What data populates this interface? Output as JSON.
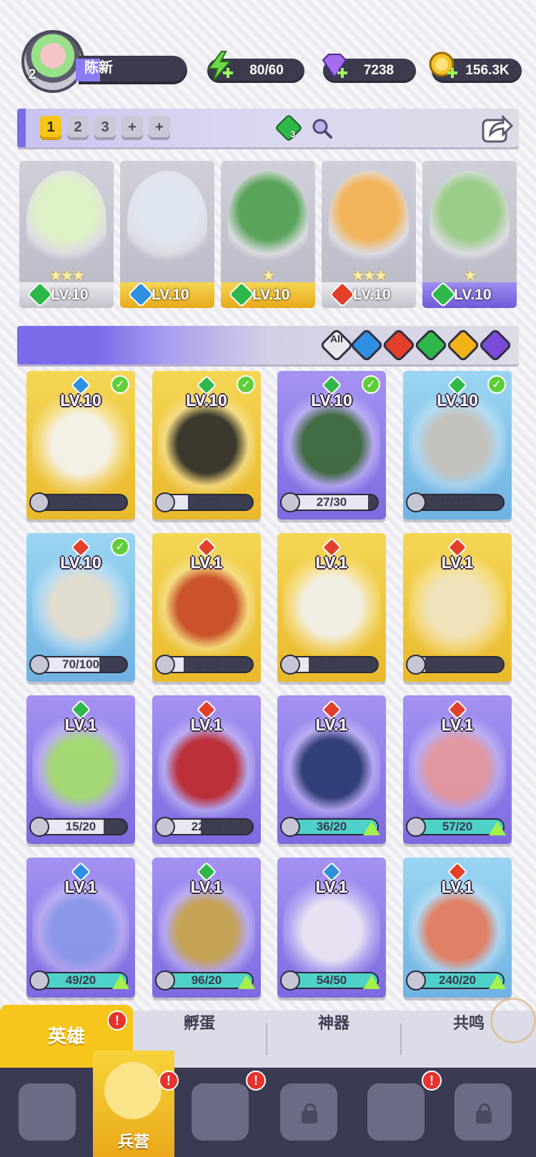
{
  "player": {
    "level": "2",
    "name": "陈新"
  },
  "resources": {
    "energy": "80/60",
    "gems": "7238",
    "gold": "156.3K"
  },
  "team": {
    "slots": [
      "1",
      "2",
      "3"
    ],
    "active_slot": "1",
    "add_slots": 2,
    "element_count": "3",
    "heroes": [
      {
        "level": "LV.10",
        "element": "nature",
        "stars": 3,
        "frame": "silver"
      },
      {
        "level": "LV.10",
        "element": "water",
        "stars": 0,
        "frame": "gold"
      },
      {
        "level": "LV.10",
        "element": "nature",
        "stars": 1,
        "frame": "gold"
      },
      {
        "level": "LV.10",
        "element": "fire",
        "stars": 3,
        "frame": "silver"
      },
      {
        "level": "LV.10",
        "element": "nature",
        "stars": 1,
        "frame": "purple"
      }
    ]
  },
  "filters": {
    "all_label": "All",
    "elements": [
      "water",
      "fire",
      "nature",
      "light",
      "dark"
    ]
  },
  "heroes": [
    {
      "level": "LV.10",
      "element": "water",
      "progress": "0/20",
      "fill": 0.0,
      "frame": "gold",
      "in_team": true,
      "upgrade": false
    },
    {
      "level": "LV.10",
      "element": "nature",
      "progress": "9/30",
      "fill": 0.3,
      "frame": "gold",
      "in_team": true,
      "upgrade": false
    },
    {
      "level": "LV.10",
      "element": "nature",
      "progress": "27/30",
      "fill": 0.9,
      "frame": "purple",
      "in_team": true,
      "upgrade": false
    },
    {
      "level": "LV.10",
      "element": "nature",
      "progress": "10/100",
      "fill": 0.1,
      "frame": "blue",
      "in_team": true,
      "upgrade": false
    },
    {
      "level": "LV.10",
      "element": "fire",
      "progress": "70/100",
      "fill": 0.7,
      "frame": "blue",
      "in_team": true,
      "upgrade": false
    },
    {
      "level": "LV.1",
      "element": "fire",
      "progress": "5/20",
      "fill": 0.25,
      "frame": "gold",
      "in_team": false,
      "upgrade": false
    },
    {
      "level": "LV.1",
      "element": "fire",
      "progress": "5/20",
      "fill": 0.25,
      "frame": "gold",
      "in_team": false,
      "upgrade": false
    },
    {
      "level": "LV.1",
      "element": "fire",
      "progress": "3/20",
      "fill": 0.15,
      "frame": "gold",
      "in_team": false,
      "upgrade": false
    },
    {
      "level": "LV.1",
      "element": "nature",
      "progress": "15/20",
      "fill": 0.75,
      "frame": "purple",
      "in_team": false,
      "upgrade": false
    },
    {
      "level": "LV.1",
      "element": "fire",
      "progress": "22/50",
      "fill": 0.44,
      "frame": "purple",
      "in_team": false,
      "upgrade": false
    },
    {
      "level": "LV.1",
      "element": "fire",
      "progress": "36/20",
      "fill": 1.0,
      "frame": "purple",
      "in_team": false,
      "upgrade": true
    },
    {
      "level": "LV.1",
      "element": "fire",
      "progress": "57/20",
      "fill": 1.0,
      "frame": "purple",
      "in_team": false,
      "upgrade": true
    },
    {
      "level": "LV.1",
      "element": "water",
      "progress": "49/20",
      "fill": 1.0,
      "frame": "purple",
      "in_team": false,
      "upgrade": true
    },
    {
      "level": "LV.1",
      "element": "nature",
      "progress": "96/20",
      "fill": 1.0,
      "frame": "purple",
      "in_team": false,
      "upgrade": true
    },
    {
      "level": "LV.1",
      "element": "water",
      "progress": "54/50",
      "fill": 1.0,
      "frame": "purple",
      "in_team": false,
      "upgrade": true
    },
    {
      "level": "LV.1",
      "element": "fire",
      "progress": "240/20",
      "fill": 1.0,
      "frame": "blue",
      "in_team": false,
      "upgrade": true
    }
  ],
  "subtabs": [
    {
      "label": "英雄",
      "active": true,
      "badge": "!"
    },
    {
      "label": "孵蛋",
      "active": false,
      "badge": ""
    },
    {
      "label": "神器",
      "active": false,
      "badge": ""
    },
    {
      "label": "共鸣",
      "active": false,
      "badge": ""
    }
  ],
  "bottom_nav": [
    {
      "icon": "cards-icon",
      "label": "",
      "active": false,
      "locked": false,
      "badge": ""
    },
    {
      "icon": "barracks-icon",
      "label": "兵营",
      "active": true,
      "locked": false,
      "badge": "!"
    },
    {
      "icon": "map-icon",
      "label": "",
      "active": false,
      "locked": false,
      "badge": "!"
    },
    {
      "icon": "shop-icon",
      "label": "",
      "active": false,
      "locked": true,
      "badge": ""
    },
    {
      "icon": "mushroom-icon",
      "label": "",
      "active": false,
      "locked": false,
      "badge": "!"
    },
    {
      "icon": "guild-icon",
      "label": "",
      "active": false,
      "locked": true,
      "badge": ""
    }
  ],
  "colors": {
    "water": "#2f8fe0",
    "fire": "#e2402a",
    "nature": "#2fb84a",
    "light": "#f2b318",
    "dark": "#7a4ad8",
    "accent_gold": "#f7c61c",
    "accent_purple": "#7a6be8"
  }
}
